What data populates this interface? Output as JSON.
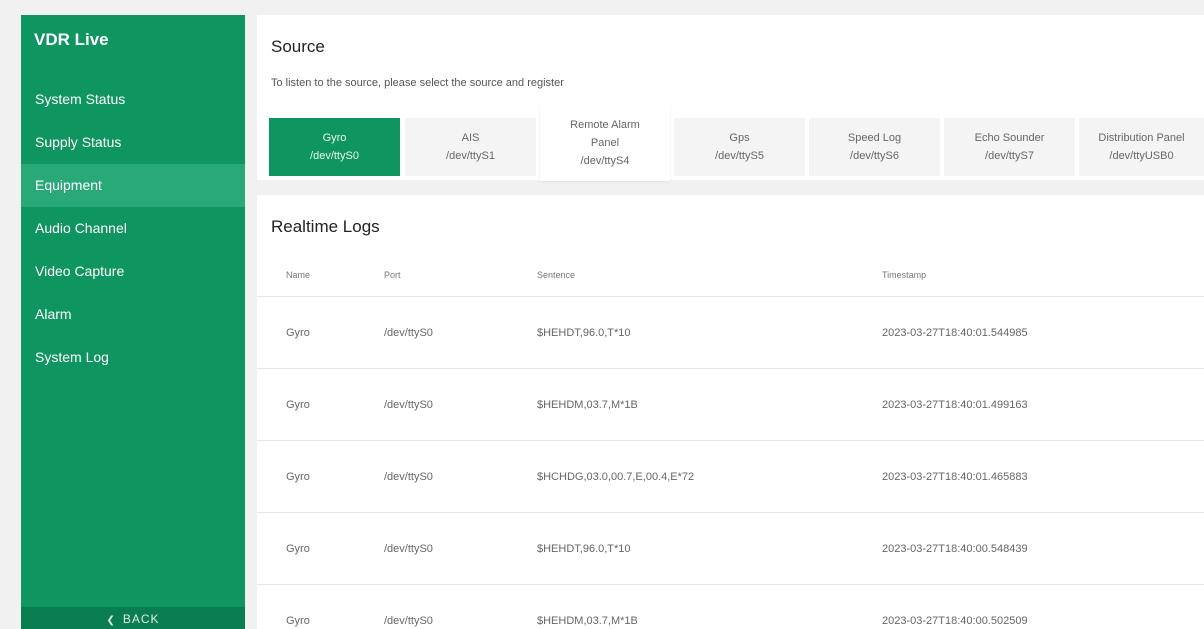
{
  "app": {
    "title": "VDR Live"
  },
  "sidebar": {
    "items": [
      {
        "label": "System Status",
        "active": false
      },
      {
        "label": "Supply Status",
        "active": false
      },
      {
        "label": "Equipment",
        "active": true
      },
      {
        "label": "Audio Channel",
        "active": false
      },
      {
        "label": "Video Capture",
        "active": false
      },
      {
        "label": "Alarm",
        "active": false
      },
      {
        "label": "System Log",
        "active": false
      }
    ],
    "back_label": "BACK",
    "back_icon": "chevron-left-icon"
  },
  "source": {
    "title": "Source",
    "description": "To listen to the source, please select the source and register",
    "tabs": [
      {
        "name": "Gyro",
        "port": "/dev/ttyS0",
        "selected": true
      },
      {
        "name": "AIS",
        "port": "/dev/ttyS1",
        "selected": false
      },
      {
        "name": "Remote Alarm Panel",
        "port": "/dev/ttyS4",
        "selected": false
      },
      {
        "name": "Gps",
        "port": "/dev/ttyS5",
        "selected": false
      },
      {
        "name": "Speed Log",
        "port": "/dev/ttyS6",
        "selected": false
      },
      {
        "name": "Echo Sounder",
        "port": "/dev/ttyS7",
        "selected": false
      },
      {
        "name": "Distribution Panel",
        "port": "/dev/ttyUSB0",
        "selected": false
      }
    ]
  },
  "logs": {
    "title": "Realtime Logs",
    "columns": {
      "name": "Name",
      "port": "Port",
      "sentence": "Sentence",
      "timestamp": "Timestamp"
    },
    "rows": [
      {
        "name": "Gyro",
        "port": "/dev/ttyS0",
        "sentence": "$HEHDT,96.0,T*10",
        "timestamp": "2023-03-27T18:40:01.544985"
      },
      {
        "name": "Gyro",
        "port": "/dev/ttyS0",
        "sentence": "$HEHDM,03.7,M*1B",
        "timestamp": "2023-03-27T18:40:01.499163"
      },
      {
        "name": "Gyro",
        "port": "/dev/ttyS0",
        "sentence": "$HCHDG,03.0,00.7,E,00.4,E*72",
        "timestamp": "2023-03-27T18:40:01.465883"
      },
      {
        "name": "Gyro",
        "port": "/dev/ttyS0",
        "sentence": "$HEHDT,96.0,T*10",
        "timestamp": "2023-03-27T18:40:00.548439"
      },
      {
        "name": "Gyro",
        "port": "/dev/ttyS0",
        "sentence": "$HEHDM,03.7,M*1B",
        "timestamp": "2023-03-27T18:40:00.502509"
      }
    ]
  },
  "colors": {
    "brand": "#0f9560",
    "active_nav": "#2aa978",
    "back_bar": "#0b7e51"
  }
}
